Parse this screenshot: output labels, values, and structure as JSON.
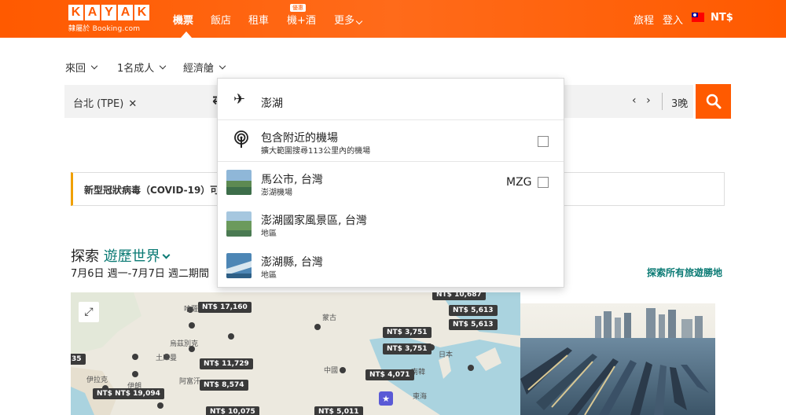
{
  "brand": {
    "letters": [
      "K",
      "A",
      "Y",
      "A",
      "K"
    ],
    "sub": "隸屬於 Booking.com",
    "color": "#ff5a00"
  },
  "nav": {
    "items": [
      "機票",
      "飯店",
      "租車",
      "機+酒",
      "更多"
    ],
    "badge": "優惠",
    "trips": "旅程",
    "login": "登入",
    "currency": "NT$"
  },
  "search_options": {
    "trip_type": "來回",
    "travelers": "1名成人",
    "cabin": "經濟艙"
  },
  "search": {
    "origin": "台北 (TPE)",
    "clear": "✕",
    "nights": "3晚",
    "prev": "‹",
    "next": "›"
  },
  "dropdown": {
    "query": "澎湖",
    "nearby_title": "包含附近的機場",
    "nearby_sub": "擴大範圍搜尋113公里內的機場",
    "results": [
      {
        "title": "馬公市, 台灣",
        "sub": "澎湖機場",
        "code": "MZG"
      },
      {
        "title": "澎湖國家風景區, 台灣",
        "sub": "地區",
        "code": ""
      },
      {
        "title": "澎湖縣, 台灣",
        "sub": "地區",
        "code": ""
      }
    ]
  },
  "notice": {
    "text": "新型冠狀病毒（COVID-19）可能"
  },
  "explore": {
    "prefix": "探索",
    "link": "遊歷世界",
    "dates": "7月6日 週一-7月7日 週二期間",
    "all_link": "探索所有旅遊勝地"
  },
  "map": {
    "prices": [
      "NT$ 17,160",
      "NT$ 10,687",
      "NT$ 5,613",
      "NT$ 5,613",
      "NT$ 3,751",
      "NT$ 3,751",
      "NT$ 11,729",
      "NT$ 4,071",
      "NT$ 8,574",
      "NT$ NT$ 19,094",
      "NT$ 10,075",
      "NT$ 5,011",
      "35"
    ],
    "labels": [
      "哈薩克",
      "蒙古",
      "烏茲別克",
      "土庫曼",
      "中國",
      "阿富汗",
      "伊拉克",
      "伊朗",
      "南韓",
      "東海",
      "日本"
    ]
  }
}
